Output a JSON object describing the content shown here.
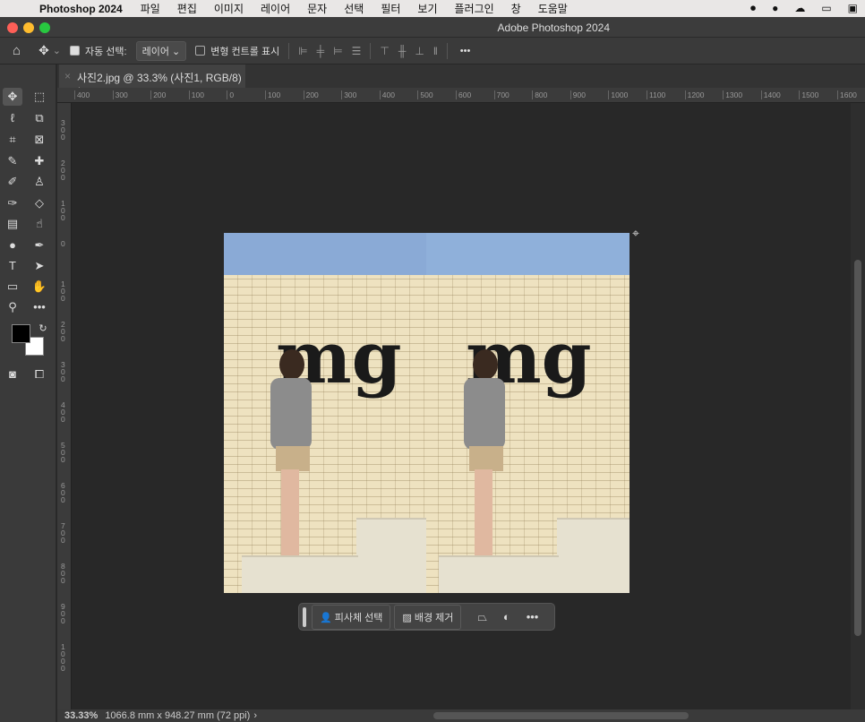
{
  "menubar": {
    "app": "Photoshop 2024",
    "items": [
      "파일",
      "편집",
      "이미지",
      "레이어",
      "문자",
      "선택",
      "필터",
      "보기",
      "플러그인",
      "창",
      "도움말"
    ]
  },
  "window": {
    "title": "Adobe Photoshop 2024"
  },
  "options": {
    "auto_select_label": "자동 선택:",
    "auto_select_checked": true,
    "auto_select_value": "레이어",
    "transform_controls_label": "변형 컨트롤 표시",
    "transform_controls_checked": false,
    "more": "•••"
  },
  "document_tab": {
    "title": "사진2.jpg @ 33.3% (사진1, RGB/8) *"
  },
  "rulers": {
    "horizontal": [
      "400",
      "300",
      "200",
      "100",
      "0",
      "100",
      "200",
      "300",
      "400",
      "500",
      "600",
      "700",
      "800",
      "900",
      "1000",
      "1100",
      "1200",
      "1300",
      "1400",
      "1500",
      "1600"
    ],
    "vertical": [
      "300",
      "200",
      "100",
      "0",
      "100",
      "200",
      "300",
      "400",
      "500",
      "600",
      "700",
      "800",
      "900",
      "1000"
    ]
  },
  "image": {
    "text": "mg"
  },
  "contextual_taskbar": {
    "select_subject": "피사체 선택",
    "remove_background": "배경 제거",
    "more": "•••"
  },
  "status": {
    "zoom": "33.33%",
    "doc_info": "1066.8 mm x 948.27 mm (72 ppi)",
    "arrow": "›"
  },
  "colors": {
    "foreground": "#000000",
    "background": "#ffffff",
    "sky": "#8aaad6",
    "wall": "#eee2c0"
  }
}
